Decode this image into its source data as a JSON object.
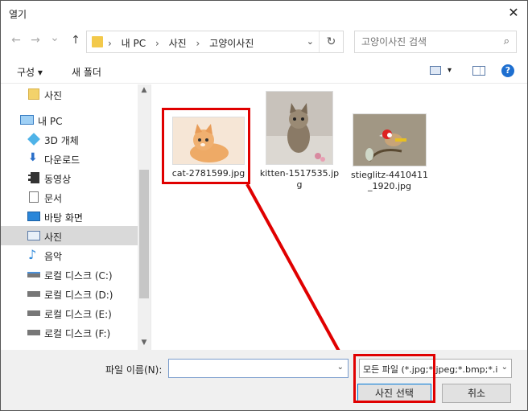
{
  "window": {
    "title": "열기",
    "close_glyph": "✕"
  },
  "nav_buttons": {
    "back": "←",
    "forward": "→",
    "recent": "⌄",
    "up": "↑"
  },
  "address": {
    "crumbs": [
      "내 PC",
      "사진",
      "고양이사진"
    ],
    "separator": "›",
    "dropdown_glyph": "⌄",
    "refresh_glyph": "↻",
    "folder_color": "#f3c94a"
  },
  "search": {
    "placeholder": "고양이사진 검색",
    "icon_glyph": "⌕"
  },
  "toolbar": {
    "organize": "구성 ▾",
    "new_folder": "새 폴더",
    "view_dd": "▾",
    "help": "?"
  },
  "nav": {
    "items": [
      {
        "label": "사진",
        "icon": "folder-icon"
      },
      {
        "label": "내 PC",
        "icon": "computer-icon"
      },
      {
        "label": "3D 개체",
        "icon": "cube-icon"
      },
      {
        "label": "다운로드",
        "icon": "download-icon"
      },
      {
        "label": "동영상",
        "icon": "video-icon"
      },
      {
        "label": "문서",
        "icon": "document-icon"
      },
      {
        "label": "바탕 화면",
        "icon": "desktop-icon"
      },
      {
        "label": "사진",
        "icon": "pictures-icon",
        "selected": true
      },
      {
        "label": "음악",
        "icon": "music-icon"
      },
      {
        "label": "로컬 디스크 (C:)",
        "icon": "drive-icon"
      },
      {
        "label": "로컬 디스크 (D:)",
        "icon": "drive-icon"
      },
      {
        "label": "로컬 디스크 (E:)",
        "icon": "drive-icon"
      },
      {
        "label": "로컬 디스크 (F:)",
        "icon": "drive-icon"
      }
    ],
    "scroll_up": "▲",
    "scroll_down": "▼"
  },
  "files": [
    {
      "name": "cat-2781599.jpg",
      "selected_highlight": true
    },
    {
      "name": "kitten-1517535.jpg"
    },
    {
      "name": "stieglitz-4410411_1920.jpg"
    }
  ],
  "bottom": {
    "filename_label": "파일 이름(N):",
    "filename_value": "",
    "filename_dd": "⌄",
    "type_value": "모든 파일 (*.jpg;*.jpeg;*.bmp;*.i",
    "type_dd": "⌄",
    "open_button": "사진 선택",
    "cancel_button": "취소"
  },
  "colors": {
    "highlight": "#e00000",
    "accent": "#0078d7"
  }
}
